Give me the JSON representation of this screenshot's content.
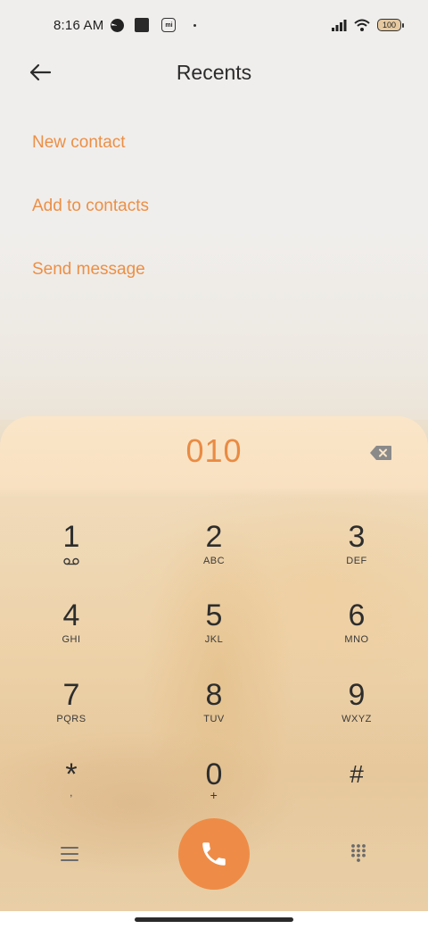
{
  "status_bar": {
    "time": "8:16 AM",
    "icons": [
      "pie-icon",
      "square-icon",
      "mi-icon",
      "dot-icon",
      "signal-icon",
      "wifi-icon"
    ],
    "mi_label": "mi",
    "battery": "100"
  },
  "header": {
    "title": "Recents",
    "back_icon": "arrow-left-icon"
  },
  "actions": [
    {
      "label": "New contact"
    },
    {
      "label": "Add to contacts"
    },
    {
      "label": "Send message"
    }
  ],
  "dialer": {
    "number": "010",
    "backspace_icon": "backspace-icon",
    "accent_color": "#ee8c47",
    "keys": [
      {
        "digit": "1",
        "letters": "",
        "icon": "voicemail-icon"
      },
      {
        "digit": "2",
        "letters": "ABC"
      },
      {
        "digit": "3",
        "letters": "DEF"
      },
      {
        "digit": "4",
        "letters": "GHI"
      },
      {
        "digit": "5",
        "letters": "JKL"
      },
      {
        "digit": "6",
        "letters": "MNO"
      },
      {
        "digit": "7",
        "letters": "PQRS"
      },
      {
        "digit": "8",
        "letters": "TUV"
      },
      {
        "digit": "9",
        "letters": "WXYZ"
      },
      {
        "digit": "*",
        "letters": ","
      },
      {
        "digit": "0",
        "letters": "+"
      },
      {
        "digit": "#",
        "letters": ""
      }
    ]
  },
  "bottom_bar": {
    "menu_icon": "menu-icon",
    "call_icon": "phone-icon",
    "keypad_icon": "dialpad-icon"
  }
}
